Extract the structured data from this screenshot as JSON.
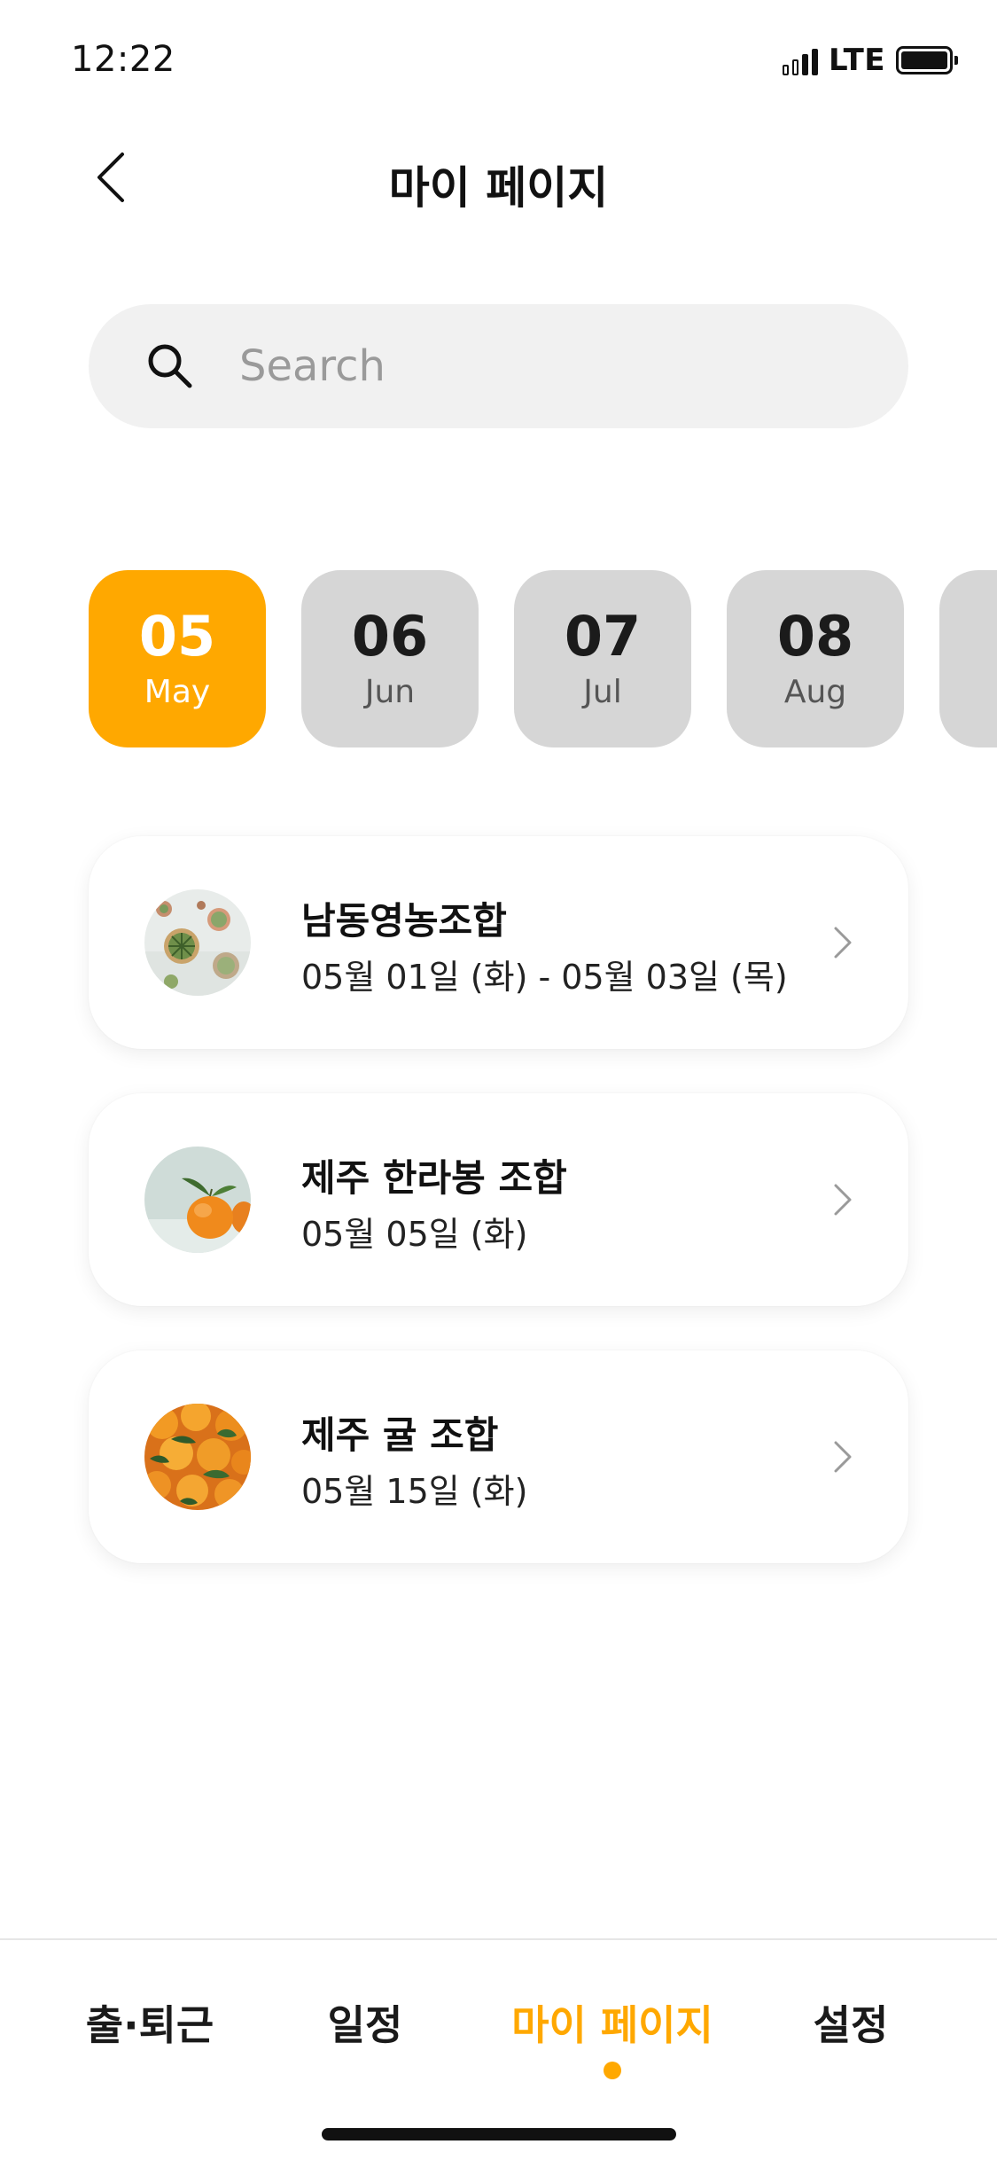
{
  "status_bar": {
    "time": "12:22",
    "network": "LTE"
  },
  "header": {
    "title": "마이 페이지",
    "back_icon": "chevron-left-icon"
  },
  "search": {
    "placeholder": "Search",
    "value": "",
    "icon": "search-icon"
  },
  "months": [
    {
      "num": "05",
      "name": "May",
      "selected": true
    },
    {
      "num": "06",
      "name": "Jun",
      "selected": false
    },
    {
      "num": "07",
      "name": "Jul",
      "selected": false
    },
    {
      "num": "08",
      "name": "Aug",
      "selected": false
    }
  ],
  "cards": [
    {
      "title": "남동영농조합",
      "date": "05월 01일 (화) - 05월 03일 (목)",
      "thumb": "plants-photo"
    },
    {
      "title": "제주 한라봉 조합",
      "date": "05월 05일 (화)",
      "thumb": "hallabong-photo"
    },
    {
      "title": "제주 귤 조합",
      "date": "05월 15일 (화)",
      "thumb": "tangerines-photo"
    }
  ],
  "tabs": [
    {
      "label": "출·퇴근",
      "active": false
    },
    {
      "label": "일정",
      "active": false
    },
    {
      "label": "마이 페이지",
      "active": true
    },
    {
      "label": "설정",
      "active": false
    }
  ],
  "colors": {
    "accent": "#ffa800",
    "chip_inactive": "#d6d6d6",
    "search_bg": "#f1f1f1"
  }
}
